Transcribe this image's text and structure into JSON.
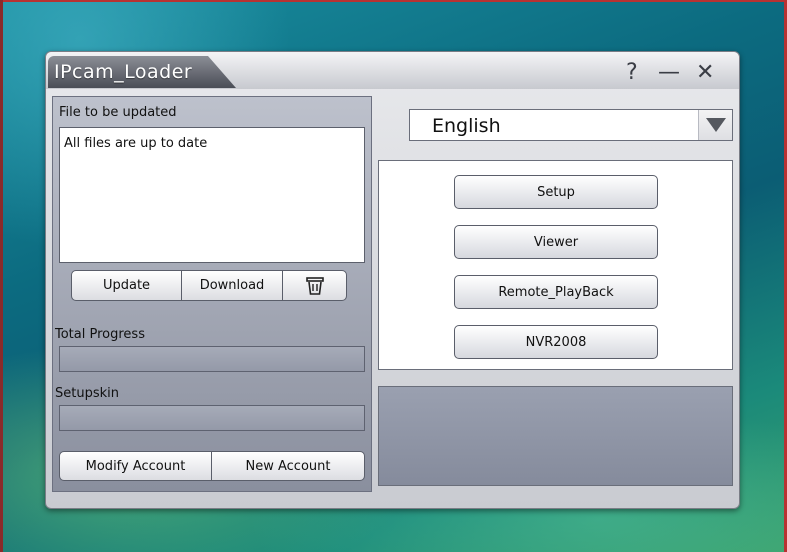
{
  "window": {
    "title": "IPcam_Loader",
    "help_label": "?",
    "minimize_label": "—",
    "close_label": "✕"
  },
  "update_panel": {
    "files_label": "File to be updated",
    "files_status": "All files are up to date",
    "update_label": "Update",
    "download_label": "Download",
    "delete_icon": "trash-icon",
    "total_progress_label": "Total Progress",
    "total_progress_value": 0,
    "setupskin_label": "Setupskin",
    "setupskin_progress_value": 0,
    "modify_account_label": "Modify Account",
    "new_account_label": "New Account"
  },
  "language": {
    "selected": "English"
  },
  "launch": {
    "buttons": [
      "Setup",
      "Viewer",
      "Remote_PlayBack",
      "NVR2008"
    ]
  },
  "colors": {
    "panel": "#9aa0b0",
    "title_tab": "#5a5d66",
    "frame_edge": "#b83232"
  }
}
